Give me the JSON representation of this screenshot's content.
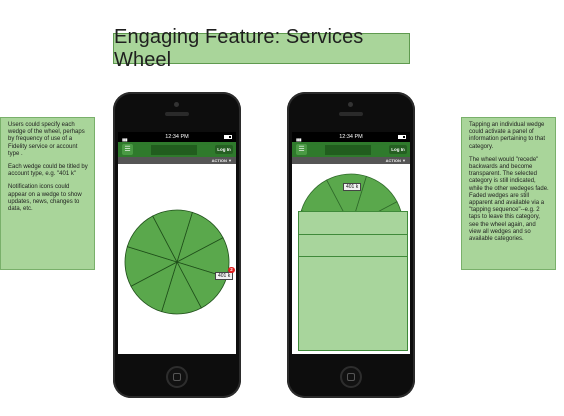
{
  "title": "Engaging Feature: Services Wheel",
  "notes": {
    "left": [
      "Users could specify each wedge of the wheel, perhaps by frequency of use of a Fidelity service or account type .",
      "Each wedge could be titled by account type, e.g. \"401 k\"",
      "Notification icons could appear on a wedge to show updates, news, changes to data, etc."
    ],
    "right": [
      "Tapping an individual wedge could activate a panel of information pertaining to that category.",
      "The wheel would \"recede\" backwards and become transparent. The selected category is still indicated, while the other wedeges fade. Faded wedges are still apparent and available via a \"tapping sequence\"--e.g. 2 taps to leave this category, see the wheel again, and view all wedges and so available categories."
    ]
  },
  "phone": {
    "time": "12:34 PM",
    "menu_icon": "☰",
    "login_label": "Log In",
    "action_label": "ACTION ▼"
  },
  "wheel": {
    "wedge_label": "401 k",
    "notification_count": "2",
    "wedge_count": 8
  },
  "colors": {
    "wheel_fill": "#5aa84c",
    "wheel_stroke": "#1f4f1a",
    "nav_green": "#2f7a2c",
    "panel_fill": "#a8d59c",
    "note_fill": "#a9d59a"
  }
}
